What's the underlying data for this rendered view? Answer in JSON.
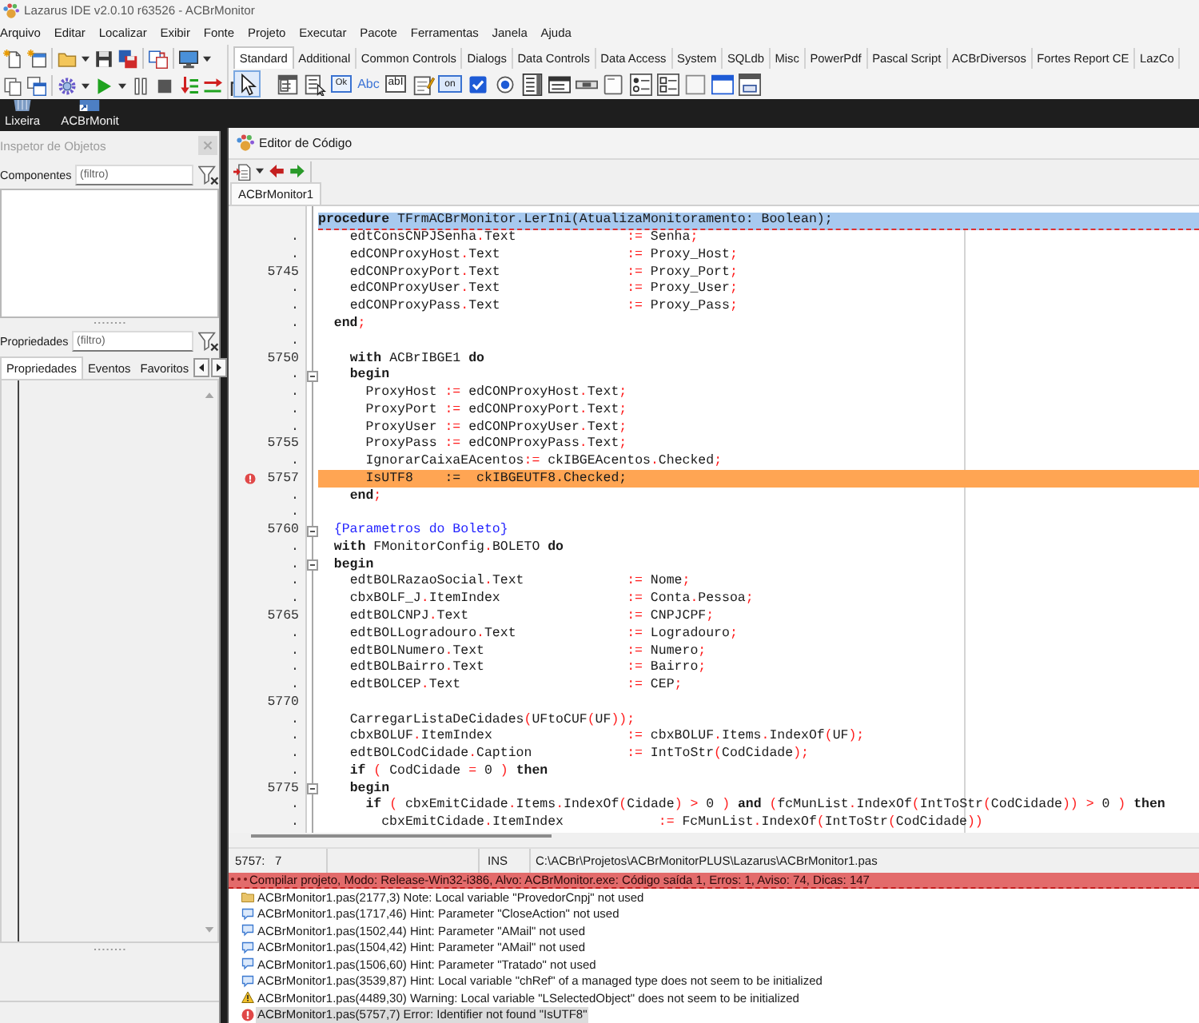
{
  "window": {
    "title": "Lazarus IDE v2.0.10 r63526 - ACBrMonitor"
  },
  "menu": [
    "Arquivo",
    "Editar",
    "Localizar",
    "Exibir",
    "Fonte",
    "Projeto",
    "Executar",
    "Pacote",
    "Ferramentas",
    "Janela",
    "Ajuda"
  ],
  "palette": {
    "tabs": [
      {
        "label": "Standard",
        "selected": true
      },
      {
        "label": "Additional",
        "selected": false
      },
      {
        "label": "Common Controls",
        "selected": false
      },
      {
        "label": "Dialogs",
        "selected": false
      },
      {
        "label": "Data Controls",
        "selected": false
      },
      {
        "label": "Data Access",
        "selected": false
      },
      {
        "label": "System",
        "selected": false
      },
      {
        "label": "SQLdb",
        "selected": false
      },
      {
        "label": "Misc",
        "selected": false
      },
      {
        "label": "PowerPdf",
        "selected": false
      },
      {
        "label": "Pascal Script",
        "selected": false
      },
      {
        "label": "ACBrDiversos",
        "selected": false
      },
      {
        "label": "Fortes Report CE",
        "selected": false
      },
      {
        "label": "LazCo",
        "selected": false
      }
    ],
    "components": [
      {
        "kind": "pointer",
        "selected": true
      },
      {
        "kind": "mainmenu",
        "selected": false
      },
      {
        "kind": "popupmenu",
        "selected": false
      },
      {
        "kind": "button",
        "glyph": "Ok",
        "selected": false
      },
      {
        "kind": "label",
        "glyph": "Abc",
        "selected": false
      },
      {
        "kind": "edit",
        "glyph": "abI",
        "selected": false
      },
      {
        "kind": "memo",
        "selected": false
      },
      {
        "kind": "toggle",
        "glyph": "on",
        "selected": false
      },
      {
        "kind": "checkbox",
        "selected": false
      },
      {
        "kind": "radio",
        "selected": false
      },
      {
        "kind": "listbox",
        "selected": false
      },
      {
        "kind": "combobox",
        "selected": false
      },
      {
        "kind": "scrollbar",
        "selected": false
      },
      {
        "kind": "groupbox",
        "selected": false
      },
      {
        "kind": "radiogroup",
        "selected": false
      },
      {
        "kind": "checkgroup",
        "selected": false
      },
      {
        "kind": "panel",
        "selected": false
      },
      {
        "kind": "frame",
        "selected": false
      },
      {
        "kind": "actionlist",
        "selected": false
      }
    ]
  },
  "desktop": {
    "icons": [
      {
        "kind": "trash",
        "label": "Lixeira"
      },
      {
        "kind": "shortcut",
        "label": "ACBrMonit"
      }
    ]
  },
  "object_inspector": {
    "title": "Inspetor de Objetos",
    "components_label": "Componentes",
    "components_filter": {
      "placeholder": "(filtro)"
    },
    "properties_label": "Propriedades",
    "properties_filter": {
      "placeholder": "(filtro)"
    },
    "tabs": [
      {
        "label": "Propriedades",
        "selected": true
      },
      {
        "label": "Eventos",
        "selected": false
      },
      {
        "label": "Favoritos",
        "selected": false
      }
    ]
  },
  "editor": {
    "title": "Editor de Código",
    "tabs": [
      {
        "label": "ACBrMonitor1",
        "selected": true
      }
    ],
    "header": "**procedure** TFrmACBrMonitor.LerIni(AtualizaMonitoramento: Boolean);",
    "lines": [
      {
        "gutter": ".",
        "kind": "assign",
        "text": "    edtConsCNPJSenha.Text",
        "value": ":= Senha;",
        "fold": false,
        "error": false
      },
      {
        "gutter": ".",
        "kind": "assign",
        "text": "    edCONProxyHost.Text",
        "value": ":= Proxy_Host;",
        "fold": false,
        "error": false
      },
      {
        "gutter": "5745",
        "kind": "assign",
        "text": "    edCONProxyPort.Text",
        "value": ":= Proxy_Port;",
        "fold": false,
        "error": false
      },
      {
        "gutter": ".",
        "kind": "assign",
        "text": "    edCONProxyUser.Text",
        "value": ":= Proxy_User;",
        "fold": false,
        "error": false
      },
      {
        "gutter": ".",
        "kind": "assign",
        "text": "    edCONProxyPass.Text",
        "value": ":= Proxy_Pass;",
        "fold": false,
        "error": false
      },
      {
        "gutter": ".",
        "kind": "code",
        "text": "  **end**;",
        "fold": false,
        "error": false
      },
      {
        "gutter": ".",
        "kind": "blank",
        "fold": false,
        "error": false
      },
      {
        "gutter": "5750",
        "kind": "code",
        "text": "    **with** ACBrIBGE1 **do**",
        "fold": false,
        "error": false
      },
      {
        "gutter": ".",
        "kind": "code",
        "text": "    **begin**",
        "fold": true,
        "error": false
      },
      {
        "gutter": ".",
        "kind": "code",
        "text": "      ProxyHost := edCONProxyHost.Text;",
        "fold": false,
        "error": false
      },
      {
        "gutter": ".",
        "kind": "code",
        "text": "      ProxyPort := edCONProxyPort.Text;",
        "fold": false,
        "error": false
      },
      {
        "gutter": ".",
        "kind": "code",
        "text": "      ProxyUser := edCONProxyUser.Text;",
        "fold": false,
        "error": false
      },
      {
        "gutter": "5755",
        "kind": "code",
        "text": "      ProxyPass := edCONProxyPass.Text;",
        "fold": false,
        "error": false
      },
      {
        "gutter": ".",
        "kind": "code",
        "text": "      IgnorarCaixaEAcentos:= ckIBGEAcentos.Checked;",
        "fold": false,
        "error": false
      },
      {
        "gutter": "5757",
        "kind": "code",
        "text": "      IsUTF8    :=  ckIBGEUTF8.Checked;",
        "fold": false,
        "error": true
      },
      {
        "gutter": ".",
        "kind": "code",
        "text": "    **end**;",
        "fold": false,
        "error": false
      },
      {
        "gutter": ".",
        "kind": "blank",
        "fold": false,
        "error": false
      },
      {
        "gutter": "5760",
        "kind": "comment",
        "text": "  {Parametros do Boleto}",
        "fold": true,
        "error": false
      },
      {
        "gutter": ".",
        "kind": "code",
        "text": "  **with** FMonitorConfig.BOLETO **do**",
        "fold": false,
        "error": false
      },
      {
        "gutter": ".",
        "kind": "code",
        "text": "  **begin**",
        "fold": true,
        "error": false
      },
      {
        "gutter": ".",
        "kind": "assign",
        "text": "    edtBOLRazaoSocial.Text",
        "value": ":= Nome;",
        "fold": false,
        "error": false
      },
      {
        "gutter": ".",
        "kind": "assign",
        "text": "    cbxBOLF_J.ItemIndex",
        "value": ":= Conta.Pessoa;",
        "fold": false,
        "error": false
      },
      {
        "gutter": "5765",
        "kind": "assign",
        "text": "    edtBOLCNPJ.Text",
        "value": ":= CNPJCPF;",
        "fold": false,
        "error": false
      },
      {
        "gutter": ".",
        "kind": "assign",
        "text": "    edtBOLLogradouro.Text",
        "value": ":= Logradouro;",
        "fold": false,
        "error": false
      },
      {
        "gutter": ".",
        "kind": "assign",
        "text": "    edtBOLNumero.Text",
        "value": ":= Numero;",
        "fold": false,
        "error": false
      },
      {
        "gutter": ".",
        "kind": "assign",
        "text": "    edtBOLBairro.Text",
        "value": ":= Bairro;",
        "fold": false,
        "error": false
      },
      {
        "gutter": ".",
        "kind": "assign",
        "text": "    edtBOLCEP.Text",
        "value": ":= CEP;",
        "fold": false,
        "error": false
      },
      {
        "gutter": "5770",
        "kind": "blank",
        "fold": false,
        "error": false
      },
      {
        "gutter": ".",
        "kind": "code",
        "text": "    CarregarListaDeCidades(UFtoCUF(UF));",
        "fold": false,
        "error": false
      },
      {
        "gutter": ".",
        "kind": "assign",
        "text": "    cbxBOLUF.ItemIndex",
        "value": ":= cbxBOLUF.Items.IndexOf(UF);",
        "fold": false,
        "error": false
      },
      {
        "gutter": ".",
        "kind": "assign",
        "text": "    edtBOLCodCidade.Caption",
        "value": ":= IntToStr(CodCidade);",
        "fold": false,
        "error": false
      },
      {
        "gutter": ".",
        "kind": "code",
        "text": "    **if** ( CodCidade = 0 ) **then**",
        "fold": false,
        "error": false
      },
      {
        "gutter": "5775",
        "kind": "code",
        "text": "    **begin**",
        "fold": true,
        "error": false
      },
      {
        "gutter": ".",
        "kind": "code",
        "text": "      **if** ( cbxEmitCidade.Items.IndexOf(Cidade) > 0 ) **and** (fcMunList.IndexOf(IntToStr(CodCidade)) > 0 ) **then**",
        "fold": false,
        "error": false
      },
      {
        "gutter": ".",
        "kind": "assign",
        "text": "        cbxEmitCidade.ItemIndex",
        "value": ":= FcMunList.IndexOf(IntToStr(CodCidade))",
        "fold": false,
        "error": false
      }
    ],
    "status": {
      "position": "5757:   7",
      "mode": "INS",
      "file": "C:\\ACBr\\Projetos\\ACBrMonitorPLUS\\Lazarus\\ACBrMonitor1.pas"
    }
  },
  "messages": {
    "summary": "Compilar projeto, Modo: Release-Win32-i386, Alvo: ACBrMonitor.exe: Código saída 1, Erros: 1, Aviso: 74, Dicas: 147",
    "items": [
      {
        "kind": "note",
        "text": "ACBrMonitor1.pas(2177,3) Note: Local variable \"ProvedorCnpj\" not used",
        "selected": false
      },
      {
        "kind": "hint",
        "text": "ACBrMonitor1.pas(1717,46) Hint: Parameter \"CloseAction\" not used",
        "selected": false
      },
      {
        "kind": "hint",
        "text": "ACBrMonitor1.pas(1502,44) Hint: Parameter \"AMail\" not used",
        "selected": false
      },
      {
        "kind": "hint",
        "text": "ACBrMonitor1.pas(1504,42) Hint: Parameter \"AMail\" not used",
        "selected": false
      },
      {
        "kind": "hint",
        "text": "ACBrMonitor1.pas(1506,60) Hint: Parameter \"Tratado\" not used",
        "selected": false
      },
      {
        "kind": "hint",
        "text": "ACBrMonitor1.pas(3539,87) Hint: Local variable \"chRef\" of a managed type does not seem to be initialized",
        "selected": false
      },
      {
        "kind": "warning",
        "text": "ACBrMonitor1.pas(4489,30) Warning: Local variable \"LSelectedObject\" does not seem to be initialized",
        "selected": false
      },
      {
        "kind": "error",
        "text": "ACBrMonitor1.pas(5757,7) Error: Identifier not found \"IsUTF8\"",
        "selected": true
      }
    ]
  }
}
